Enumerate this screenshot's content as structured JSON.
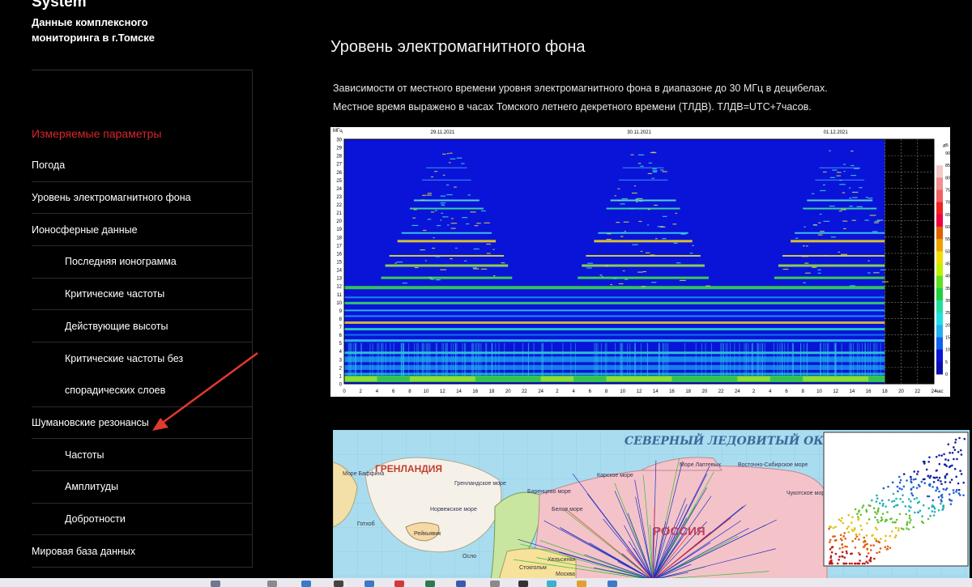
{
  "sidebar": {
    "brand_system": "System",
    "brand_subtitle": "Данные комплексного мониторинга в г.Томске",
    "nav_header": "Измеряемые параметры",
    "items": [
      {
        "label": "Погода"
      },
      {
        "label": "Уровень электромагнитного фона"
      },
      {
        "label": "Ионосферные данные"
      },
      {
        "label": "Последняя ионограмма"
      },
      {
        "label": "Критические частоты"
      },
      {
        "label": "Действующие высоты"
      },
      {
        "label": "Критические частоты без"
      },
      {
        "label": "спорадических слоев"
      },
      {
        "label": "Шумановские резонансы"
      },
      {
        "label": "Частоты"
      },
      {
        "label": "Амплитуды"
      },
      {
        "label": "Добротности"
      },
      {
        "label": "Мировая база данных"
      }
    ]
  },
  "main": {
    "title": "Уровень электромагнитного фона",
    "description_line1": "Зависимости от местного времени уровня электромагнитного фона в диапазоне до 30 МГц в децибелах.",
    "description_line2": "Местное время выражено в часах Томского летнего декретного времени (ТЛДВ). ТЛДВ=UTC+7часов."
  },
  "spectrogram": {
    "y_unit": "МГц",
    "x_unit": "час",
    "colorbar_unit": "дБ",
    "date_labels": [
      "29.11.2021",
      "30.11.2021",
      "01.12.2021"
    ],
    "y_ticks": [
      "0",
      "1",
      "2",
      "3",
      "4",
      "5",
      "6",
      "7",
      "8",
      "9",
      "10",
      "11",
      "12",
      "13",
      "14",
      "15",
      "16",
      "17",
      "18",
      "19",
      "20",
      "21",
      "22",
      "23",
      "24",
      "25",
      "26",
      "27",
      "28",
      "29",
      "30"
    ],
    "x_ticks": [
      "0",
      "2",
      "4",
      "6",
      "8",
      "10",
      "12",
      "14",
      "16",
      "18",
      "20",
      "22",
      "24",
      "2",
      "4",
      "6",
      "8",
      "10",
      "12",
      "14",
      "16",
      "18",
      "20",
      "22",
      "24",
      "2",
      "4",
      "6",
      "8",
      "10",
      "12",
      "14",
      "16",
      "18",
      "20",
      "22",
      "24"
    ],
    "colorbar_ticks": [
      "90",
      "85",
      "80",
      "75",
      "70",
      "65",
      "60",
      "55",
      "50",
      "45",
      "40",
      "35",
      "30",
      "25",
      "20",
      "15",
      "10",
      "5",
      "0"
    ]
  },
  "map": {
    "ocean_label": "СЕВЕРНЫЙ ЛЕДОВИТЫЙ ОКЕАН",
    "greenland_label": "ГРЕНЛАНДИЯ",
    "russia_label": "РОССИЯ",
    "sea_labels": [
      "Море Баффина",
      "Гренландское море",
      "Баренцево море",
      "Норвежское море",
      "Карское море",
      "Море Лаптевых",
      "Восточно-Сибирское море",
      "Чукотское море",
      "Белое море"
    ],
    "city_labels": [
      "Рейкьявик",
      "Осло",
      "Стокгольм",
      "Хельсинки",
      "Москва",
      "Готхоб"
    ]
  },
  "colors": {
    "accent_red": "#d9262f",
    "spectro_background": "#0a14d8"
  }
}
